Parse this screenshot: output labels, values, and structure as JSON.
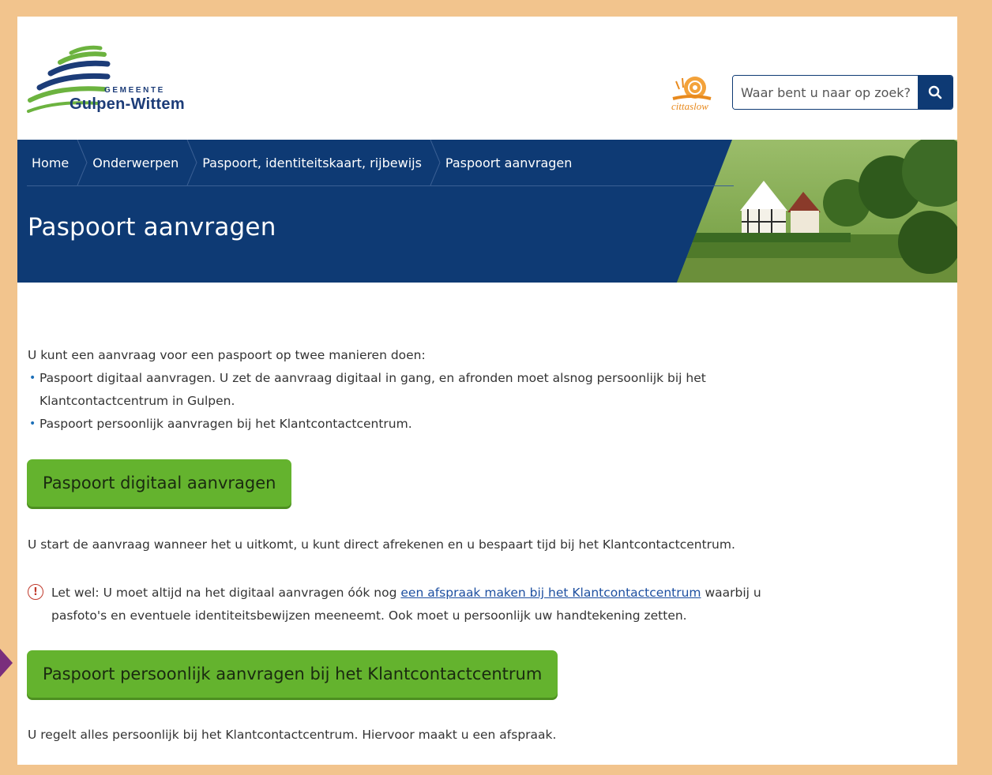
{
  "header": {
    "logo_small": "GEMEENTE",
    "logo_name": "Gulpen-Wittem",
    "cittaslow_label": "cittaslow",
    "search": {
      "placeholder": "Waar bent u naar op zoek?"
    }
  },
  "breadcrumb": [
    "Home",
    "Onderwerpen",
    "Paspoort, identiteitskaart, rijbewijs",
    "Paspoort aanvragen"
  ],
  "page_title": "Paspoort aanvragen",
  "intro": "U kunt een aanvraag voor een paspoort op twee manieren doen:",
  "options": [
    "Paspoort digitaal aanvragen. U zet de aanvraag digitaal in gang, en afronden moet alsnog persoonlijk bij het Klantcontactcentrum in Gulpen.",
    "Paspoort persoonlijk aanvragen bij het Klantcontactcentrum."
  ],
  "button_digital": "Paspoort digitaal aanvragen",
  "digital_desc": "U start de aanvraag wanneer het u uitkomt, u kunt direct afrekenen en u bespaart tijd bij het Klantcontactcentrum.",
  "notice": {
    "icon": "!",
    "before": "Let wel: U moet altijd na het digitaal aanvragen óók nog ",
    "link": "een afspraak maken bij het Klantcontactcentrum",
    "after": " waarbij u pasfoto's en eventuele identiteitsbewijzen meeneemt. Ook moet u persoonlijk uw handtekening zetten."
  },
  "button_personal": "Paspoort persoonlijk aanvragen bij het Klantcontactcentrum",
  "personal_desc": "U regelt alles persoonlijk bij het Klantcontactcentrum. Hiervoor maakt u een afspraak.",
  "colors": {
    "navy": "#0e3a74",
    "green": "#64b32e",
    "frame": "#f2c48d",
    "marker": "#7a2e7c"
  }
}
